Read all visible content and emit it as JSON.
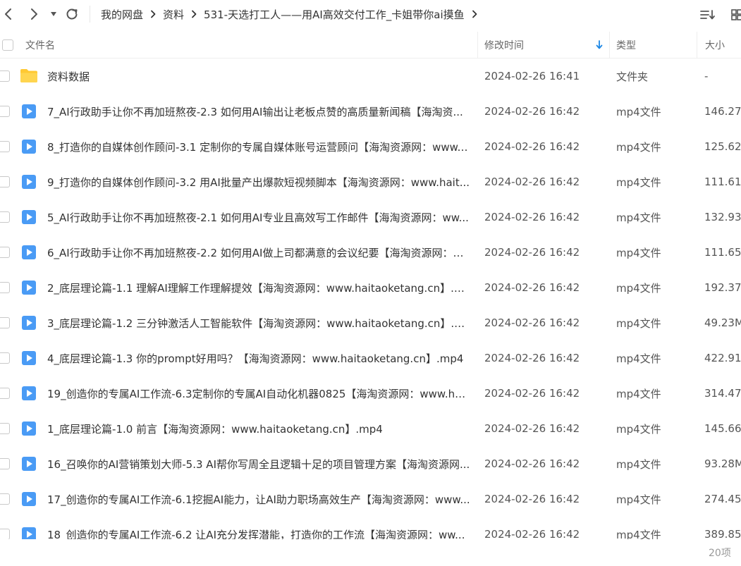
{
  "breadcrumb": [
    "我的网盘",
    "资料",
    "531-天选打工人——用AI高效交付工作_卡姐带你ai摸鱼"
  ],
  "columns": {
    "name": "文件名",
    "modified": "修改时间",
    "type": "类型",
    "size": "大小"
  },
  "sort": {
    "column": "modified",
    "direction": "descending"
  },
  "icons": {
    "back": "chevron-left-icon",
    "forward": "chevron-right-icon",
    "history": "caret-down-icon",
    "refresh": "refresh-icon",
    "breadcrumb_separator": "chevron-right-icon",
    "sort_menu": "sort-list-icon",
    "sort_indicator": "arrow-down-icon",
    "folder": "folder-icon",
    "video": "video-file-icon"
  },
  "colors": {
    "folder": "#FFC933",
    "video": "#4A9BF5",
    "sort_indicator": "#1E88E5"
  },
  "files": [
    {
      "name": "资料数据",
      "modified": "2024-02-26 16:41",
      "type": "文件夹",
      "size": "-",
      "icon": "folder"
    },
    {
      "name": "7_AI行政助手让你不再加班熬夜-2.3 如何用AI输出让老板点赞的高质量新闻稿【海淘资...",
      "modified": "2024-02-26 16:42",
      "type": "mp4文件",
      "size": "146.27",
      "icon": "video"
    },
    {
      "name": "8_打造你的自媒体创作顾问-3.1 定制你的专属自媒体账号运营顾问【海淘资源网：www....",
      "modified": "2024-02-26 16:42",
      "type": "mp4文件",
      "size": "125.62",
      "icon": "video"
    },
    {
      "name": "9_打造你的自媒体创作顾问-3.2 用AI批量产出爆款短视频脚本【海淘资源网：www.hait...",
      "modified": "2024-02-26 16:42",
      "type": "mp4文件",
      "size": "111.61",
      "icon": "video"
    },
    {
      "name": "5_AI行政助手让你不再加班熬夜-2.1 如何用AI专业且高效写工作邮件【海淘资源网：ww...",
      "modified": "2024-02-26 16:42",
      "type": "mp4文件",
      "size": "132.93",
      "icon": "video"
    },
    {
      "name": "6_AI行政助手让你不再加班熬夜-2.2 如何用AI做上司都满意的会议纪要【海淘资源网：w...",
      "modified": "2024-02-26 16:42",
      "type": "mp4文件",
      "size": "111.65",
      "icon": "video"
    },
    {
      "name": "2_底层理论篇-1.1 理解AI理解工作理解提效【海淘资源网：www.haitaoketang.cn】.m...",
      "modified": "2024-02-26 16:42",
      "type": "mp4文件",
      "size": "192.37",
      "icon": "video"
    },
    {
      "name": "3_底层理论篇-1.2 三分钟激活人工智能软件【海淘资源网：www.haitaoketang.cn】.m...",
      "modified": "2024-02-26 16:42",
      "type": "mp4文件",
      "size": "49.23M",
      "icon": "video"
    },
    {
      "name": "4_底层理论篇-1.3 你的prompt好用吗？【海淘资源网：www.haitaoketang.cn】.mp4",
      "modified": "2024-02-26 16:42",
      "type": "mp4文件",
      "size": "422.91",
      "icon": "video"
    },
    {
      "name": "19_创造你的专属AI工作流-6.3定制你的专属AI自动化机器0825【海淘资源网：www.hai...",
      "modified": "2024-02-26 16:42",
      "type": "mp4文件",
      "size": "314.47",
      "icon": "video"
    },
    {
      "name": "1_底层理论篇-1.0 前言【海淘资源网：www.haitaoketang.cn】.mp4",
      "modified": "2024-02-26 16:42",
      "type": "mp4文件",
      "size": "145.66",
      "icon": "video"
    },
    {
      "name": "16_召唤你的AI营销策划大师-5.3 AI帮你写周全且逻辑十足的项目管理方案【海淘资源网...",
      "modified": "2024-02-26 16:42",
      "type": "mp4文件",
      "size": "93.28M",
      "icon": "video"
    },
    {
      "name": "17_创造你的专属AI工作流-6.1挖掘AI能力，让AI助力职场高效生产【海淘资源网：www...",
      "modified": "2024-02-26 16:42",
      "type": "mp4文件",
      "size": "274.45",
      "icon": "video"
    },
    {
      "name": "18_创造你的专属AI工作流-6.2 让AI充分发挥潜能，打造你的工作流【海淘资源网：ww...",
      "modified": "2024-02-26 16:42",
      "type": "mp4文件",
      "size": "389.85",
      "icon": "video"
    }
  ],
  "footer": {
    "count": "20项"
  }
}
